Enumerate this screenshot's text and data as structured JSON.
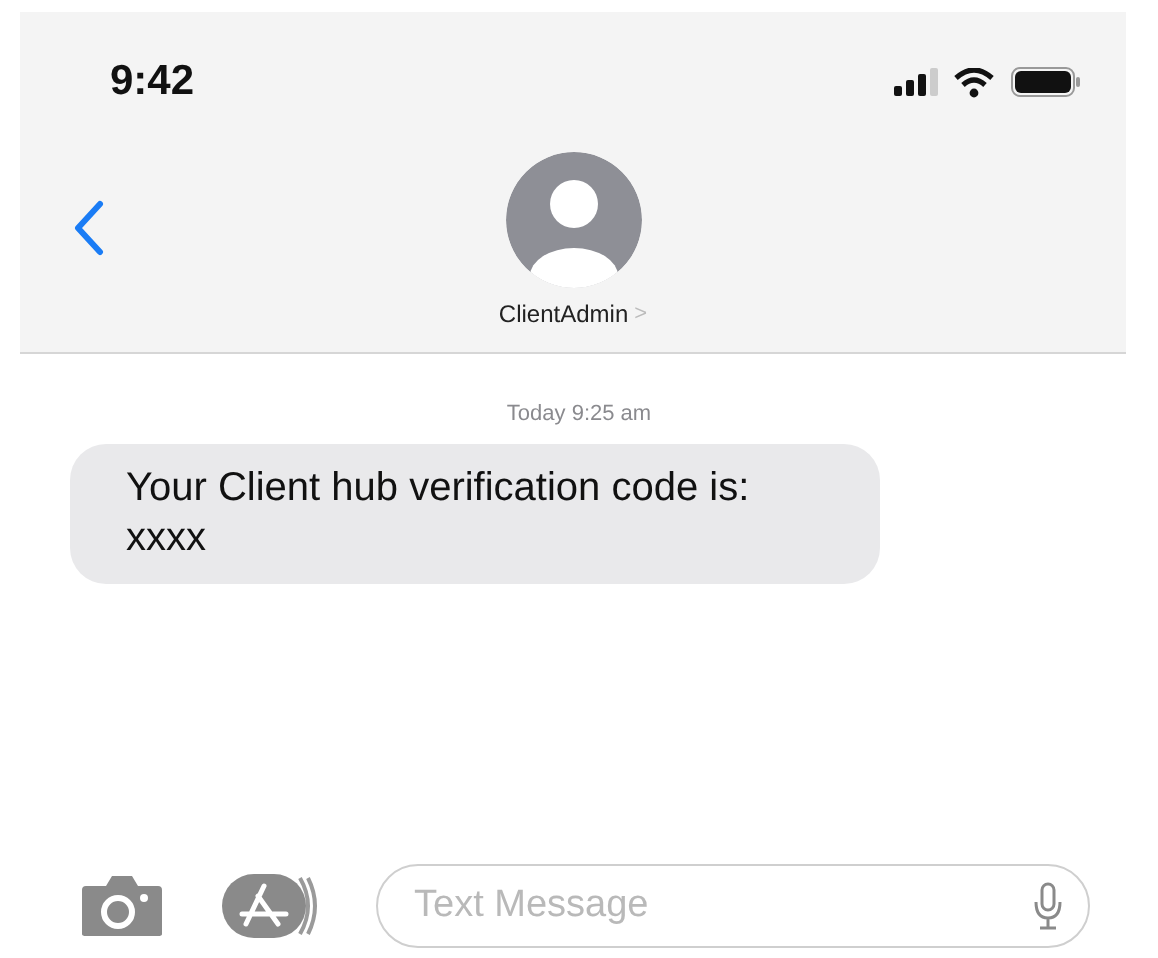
{
  "status_bar": {
    "time": "9:42"
  },
  "header": {
    "contact_name": "ClientAdmin",
    "name_chevron": ">"
  },
  "messages": [
    {
      "timestamp": "Today 9:25 am",
      "text": "Your Client hub verification code is: xxxx",
      "incoming": true
    }
  ],
  "composer": {
    "placeholder": "Text Message"
  }
}
